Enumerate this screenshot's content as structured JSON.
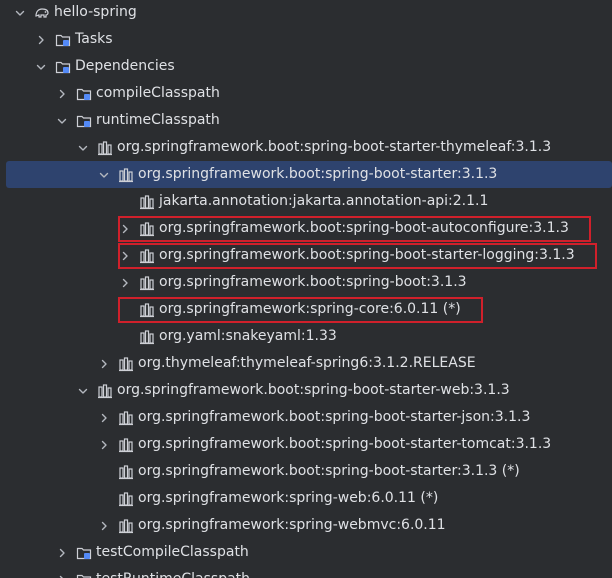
{
  "tree": {
    "rows": [
      {
        "label": "hello-spring",
        "depth": 0,
        "expander": "expanded",
        "icon": "gradle-elephant-icon"
      },
      {
        "label": "Tasks",
        "depth": 1,
        "expander": "collapsed",
        "icon": "folder-tasks-icon"
      },
      {
        "label": "Dependencies",
        "depth": 1,
        "expander": "expanded",
        "icon": "folder-dependencies-icon"
      },
      {
        "label": "compileClasspath",
        "depth": 2,
        "expander": "collapsed",
        "icon": "folder-config-icon"
      },
      {
        "label": "runtimeClasspath",
        "depth": 2,
        "expander": "expanded",
        "icon": "folder-config-icon"
      },
      {
        "label": "org.springframework.boot:spring-boot-starter-thymeleaf:3.1.3",
        "depth": 3,
        "expander": "expanded",
        "icon": "library-icon"
      },
      {
        "label": "org.springframework.boot:spring-boot-starter:3.1.3",
        "depth": 4,
        "expander": "expanded",
        "icon": "library-icon",
        "selected": true
      },
      {
        "label": "jakarta.annotation:jakarta.annotation-api:2.1.1",
        "depth": 5,
        "expander": "none",
        "icon": "library-icon"
      },
      {
        "label": "org.springframework.boot:spring-boot-autoconfigure:3.1.3",
        "depth": 5,
        "expander": "collapsed",
        "icon": "library-icon",
        "highlighted": true
      },
      {
        "label": "org.springframework.boot:spring-boot-starter-logging:3.1.3",
        "depth": 5,
        "expander": "collapsed",
        "icon": "library-icon",
        "highlighted": true
      },
      {
        "label": "org.springframework.boot:spring-boot:3.1.3",
        "depth": 5,
        "expander": "collapsed",
        "icon": "library-icon"
      },
      {
        "label": "org.springframework:spring-core:6.0.11 (*)",
        "depth": 5,
        "expander": "none",
        "icon": "library-icon",
        "highlighted": true
      },
      {
        "label": "org.yaml:snakeyaml:1.33",
        "depth": 5,
        "expander": "none",
        "icon": "library-icon"
      },
      {
        "label": "org.thymeleaf:thymeleaf-spring6:3.1.2.RELEASE",
        "depth": 4,
        "expander": "collapsed",
        "icon": "library-icon"
      },
      {
        "label": "org.springframework.boot:spring-boot-starter-web:3.1.3",
        "depth": 3,
        "expander": "expanded",
        "icon": "library-icon"
      },
      {
        "label": "org.springframework.boot:spring-boot-starter-json:3.1.3",
        "depth": 4,
        "expander": "collapsed",
        "icon": "library-icon"
      },
      {
        "label": "org.springframework.boot:spring-boot-starter-tomcat:3.1.3",
        "depth": 4,
        "expander": "collapsed",
        "icon": "library-icon"
      },
      {
        "label": "org.springframework.boot:spring-boot-starter:3.1.3 (*)",
        "depth": 4,
        "expander": "none",
        "icon": "library-icon"
      },
      {
        "label": "org.springframework:spring-web:6.0.11 (*)",
        "depth": 4,
        "expander": "none",
        "icon": "library-icon"
      },
      {
        "label": "org.springframework:spring-webmvc:6.0.11",
        "depth": 4,
        "expander": "collapsed",
        "icon": "library-icon"
      },
      {
        "label": "testCompileClasspath",
        "depth": 2,
        "expander": "collapsed",
        "icon": "folder-config-icon"
      },
      {
        "label": "testRuntimeClasspath",
        "depth": 2,
        "expander": "collapsed",
        "icon": "folder-config-icon"
      }
    ]
  },
  "colors": {
    "background": "#2b2d30",
    "text": "#dfe1e5",
    "selection": "#2e436e",
    "highlight_box": "#d0202b",
    "icon_stroke": "#ced0d6",
    "folder_blue": "#548af7"
  }
}
